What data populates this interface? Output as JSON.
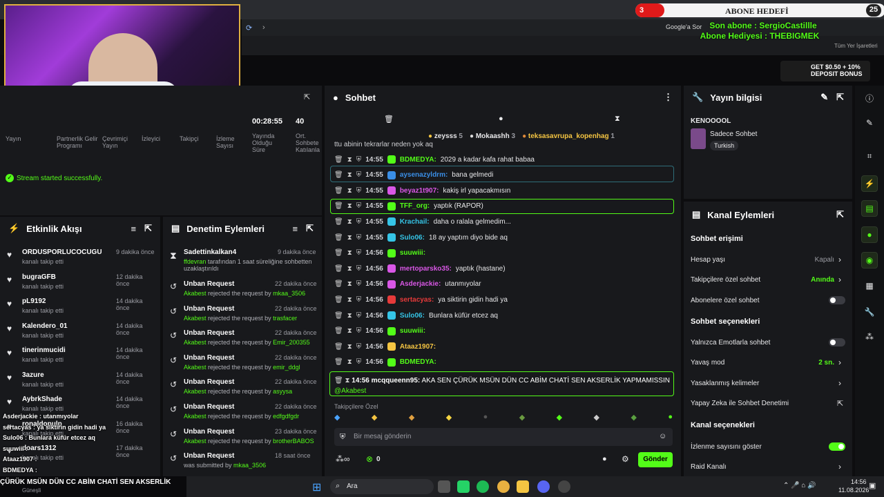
{
  "overlay": {
    "sub_goal_label": "ABONE HEDEFİ",
    "sub_goal_current": "3",
    "sub_goal_target": "25",
    "last_sub": "Son abone : SergioCastillle",
    "gift_sub": "Abone Hediyesi : THEBIGMEK",
    "ad_text": "GET $0.50 + 10% DEPOSIT BONUS"
  },
  "browser": {
    "google_translate": "Google'a Sor",
    "all_bookmarks": "Tüm Yer İşaretleri"
  },
  "stats": {
    "duration": "00:28:55",
    "count": "40",
    "labels": [
      "Yayın",
      "Partnerlik Gelir Programı",
      "Çevrimiçi Yayın",
      "İzleyici",
      "Takipçi",
      "İzleme Sayısı",
      "Yayında Olduğu Süre",
      "Ort. Sohbete Katılanla"
    ],
    "toast": "Stream started successfully."
  },
  "activity": {
    "title": "Etkinlik Akışı",
    "items": [
      {
        "user": "ORDUSPORLUCOCUGU",
        "sub": "kanalı takip etti",
        "time": "9 dakika önce"
      },
      {
        "user": "bugraGFB",
        "sub": "kanalı takip etti",
        "time": "12 dakika önce"
      },
      {
        "user": "pL9192",
        "sub": "kanalı takip etti",
        "time": "14 dakika önce"
      },
      {
        "user": "Kalendero_01",
        "sub": "kanalı takip etti",
        "time": "14 dakika önce"
      },
      {
        "user": "tinerinmucidi",
        "sub": "kanalı takip etti",
        "time": "14 dakika önce"
      },
      {
        "user": "3azure",
        "sub": "kanalı takip etti",
        "time": "14 dakika önce"
      },
      {
        "user": "AybrkShade",
        "sub": "kanalı takip etti",
        "time": "14 dakika önce"
      },
      {
        "user": "ronaldopulp",
        "sub": "kanalı takip etti",
        "time": "16 dakika önce"
      },
      {
        "user": "doars1312",
        "sub": "kanalı takip etti",
        "time": "17 dakika önce"
      }
    ]
  },
  "moderation": {
    "title": "Denetim Eylemleri",
    "first": {
      "user": "Sadettinkalkan4",
      "time": "9 dakika önce",
      "by": "ffdevran",
      "text": "tarafından 1 saat süreliğine sohbetten uzaklaştırıldı"
    },
    "items": [
      {
        "title": "Unban Request",
        "time": "22 dakika önce",
        "by": "Akabest",
        "action": "rejected the request by",
        "target": "mkaa_3506"
      },
      {
        "title": "Unban Request",
        "time": "22 dakika önce",
        "by": "Akabest",
        "action": "rejected the request by",
        "target": "trasfacer"
      },
      {
        "title": "Unban Request",
        "time": "22 dakika önce",
        "by": "Akabest",
        "action": "rejected the request by",
        "target": "Emir_200355"
      },
      {
        "title": "Unban Request",
        "time": "22 dakika önce",
        "by": "Akabest",
        "action": "rejected the request by",
        "target": "emir_ddgl"
      },
      {
        "title": "Unban Request",
        "time": "22 dakika önce",
        "by": "Akabest",
        "action": "rejected the request by",
        "target": "asyysa"
      },
      {
        "title": "Unban Request",
        "time": "22 dakika önce",
        "by": "Akabest",
        "action": "rejected the request by",
        "target": "edfgdfgdr"
      },
      {
        "title": "Unban Request",
        "time": "23 dakika önce",
        "by": "Akabest",
        "action": "rejected the request by",
        "target": "brotherBABOS"
      },
      {
        "title": "Unban Request",
        "time": "18 saat önce",
        "by": "",
        "action": "was submitted by",
        "target": "mkaa_3506"
      }
    ]
  },
  "chat": {
    "title": "Sohbet",
    "top": [
      {
        "user": "zeysss",
        "n": "5"
      },
      {
        "user": "Mokaashh",
        "n": "3"
      },
      {
        "user": "teksasavrupa_kopenhag",
        "n": "1"
      }
    ],
    "first_partial": "ttu abinin tekrarlar neden yok aq",
    "messages": [
      {
        "time": "14:55",
        "user": "BDMEDYA:",
        "text": "2029 a kadar kafa rahat babaa",
        "color": "#53fc18"
      },
      {
        "time": "14:55",
        "user": "aysenazyldrm:",
        "text": "bana gelmedi",
        "color": "#3a8ee6"
      },
      {
        "time": "14:55",
        "user": "beyaz1t907:",
        "text": "kakiş irl yapacakmısın",
        "color": "#d957e6"
      },
      {
        "time": "14:55",
        "user": "TFF_org:",
        "text": "yaptık (RAPOR)",
        "color": "#53fc18"
      },
      {
        "time": "14:55",
        "user": "Krachail:",
        "text": "daha o ralala gelmedim...",
        "color": "#35c4e6"
      },
      {
        "time": "14:55",
        "user": "Sulo06:",
        "text": "18 ay yaptım diyo bide aq",
        "color": "#35c4e6"
      },
      {
        "time": "14:56",
        "user": "suuwiii:",
        "text": "",
        "color": "#53fc18"
      },
      {
        "time": "14:56",
        "user": "mertoparsko35:",
        "text": "yaptık (hastane)",
        "color": "#d957e6"
      },
      {
        "time": "14:56",
        "user": "Asderjackie:",
        "text": "utanmıyolar",
        "color": "#d957e6"
      },
      {
        "time": "14:56",
        "user": "sertacyas:",
        "text": "ya siktirin gidin hadi ya",
        "color": "#e63a3a"
      },
      {
        "time": "14:56",
        "user": "Sulo06:",
        "text": "Bunlara küfür etcez aq",
        "color": "#35c4e6"
      },
      {
        "time": "14:56",
        "user": "suuwiii:",
        "text": "",
        "color": "#53fc18"
      },
      {
        "time": "14:56",
        "user": "Ataaz1907:",
        "text": "",
        "color": "#f5c542"
      },
      {
        "time": "14:56",
        "user": "BDMEDYA:",
        "text": "",
        "color": "#53fc18"
      }
    ],
    "pinned_time": "14:56",
    "pinned_user": "mcqqueenn95:",
    "pinned_text": "AKA SEN ÇÜRÜK MSÜN DÜN CC ABİM CHATİ SEN AKSERLİK YAPMAMISSIN",
    "pinned_mention": "@Akabest",
    "emote_label": "Takipçilere Özel",
    "input_placeholder": "Bir mesaj gönderin",
    "send_label": "Gönder",
    "count": "0"
  },
  "stream_info": {
    "title": "Yayın bilgisi",
    "channel": "KENOOOOL",
    "category": "Sadece Sohbet",
    "tag": "Turkish"
  },
  "channel_actions": {
    "title": "Kanal Eylemleri",
    "sec1": "Sohbet erişimi",
    "rows1": [
      {
        "label": "Hesap yaşı",
        "value": "Kapalı",
        "green": false
      },
      {
        "label": "Takipçilere özel sohbet",
        "value": "Anında",
        "green": true
      },
      {
        "label": "Abonelere özel sohbet",
        "value": "",
        "green": false
      }
    ],
    "sec2": "Sohbet seçenekleri",
    "rows2": [
      {
        "label": "Yalnızca Emotlarla sohbet",
        "value": "",
        "green": false
      },
      {
        "label": "Yavaş mod",
        "value": "2 sn.",
        "green": true
      },
      {
        "label": "Yasaklanmış kelimeler",
        "value": "",
        "green": false
      },
      {
        "label": "Yapay Zeka ile Sohbet Denetimi",
        "value": "",
        "green": false
      }
    ],
    "sec3": "Kanal seçenekleri",
    "rows3": [
      {
        "label": "İzlenme sayısını göster",
        "value": "",
        "green": false
      },
      {
        "label": "Raid Kanalı",
        "value": "",
        "green": false
      }
    ]
  },
  "overlay_chat": [
    {
      "user": "Asderjackie",
      "text": "utanmıyolar"
    },
    {
      "user": "sertacyas",
      "text": "ya siktirin gidin hadi ya"
    },
    {
      "user": "Sulo06",
      "text": "Bunlara küfür etcez aq"
    },
    {
      "user": "suuwiii",
      "text": ""
    },
    {
      "user": "Ataaz1907",
      "text": ""
    },
    {
      "user": "BDMEDYA",
      "text": ""
    }
  ],
  "ticker": "ÇÜRÜK MSÜN DÜN CC ABİM CHATİ SEN AKSERLİK",
  "weather": "Güneşli",
  "taskbar": {
    "search": "Ara",
    "time": "14:56",
    "date": "11.08.2026"
  },
  "colors": {
    "accent": "#53fc18",
    "panel": "#18191c",
    "bg": "#0d0d0f"
  }
}
